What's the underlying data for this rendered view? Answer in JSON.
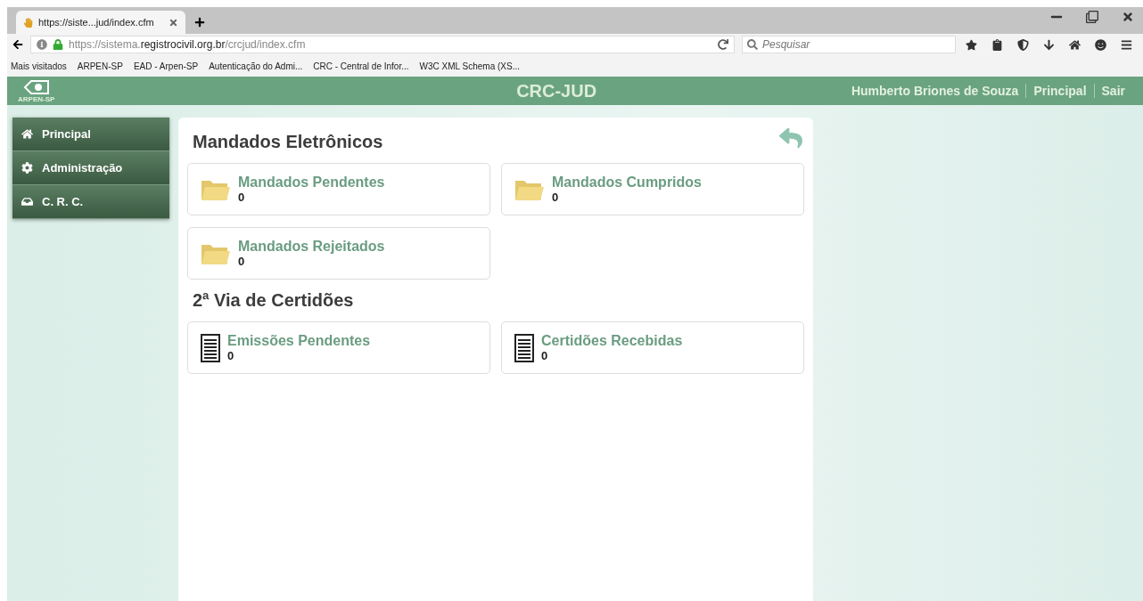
{
  "browser": {
    "tab_title": "https://siste...jud/index.cfm",
    "url_prefix": "https://sistema.",
    "url_domain": "registrocivil.org.br",
    "url_path": "/crcjud/index.cfm",
    "search_placeholder": "Pesquisar",
    "bookmarks": [
      "Mais visitados",
      "ARPEN-SP",
      "EAD - Arpen-SP",
      "Autenticação do Admi...",
      "CRC - Central de Infor...",
      "W3C XML Schema (XS..."
    ]
  },
  "header": {
    "logo_text": "ARPEN-SP",
    "title": "CRC-JUD",
    "links": [
      "Humberto Briones de Souza",
      "Principal",
      "Sair"
    ]
  },
  "sidebar": {
    "items": [
      {
        "label": "Principal",
        "kind": "home"
      },
      {
        "label": "Administração",
        "kind": "gear"
      },
      {
        "label": "C. R. C.",
        "kind": "inbox"
      }
    ]
  },
  "sections": [
    {
      "title": "Mandados Eletrônicos",
      "cards": [
        {
          "label": "Mandados Pendentes",
          "count": "0",
          "kind": "folder"
        },
        {
          "label": "Mandados Cumpridos",
          "count": "0",
          "kind": "folder"
        },
        {
          "label": "Mandados Rejeitados",
          "count": "0",
          "kind": "folder"
        }
      ]
    },
    {
      "title": "2ª Via de Certidões",
      "cards": [
        {
          "label": "Emissões Pendentes",
          "count": "0",
          "kind": "document"
        },
        {
          "label": "Certidões Recebidas",
          "count": "0",
          "kind": "document"
        }
      ]
    }
  ]
}
